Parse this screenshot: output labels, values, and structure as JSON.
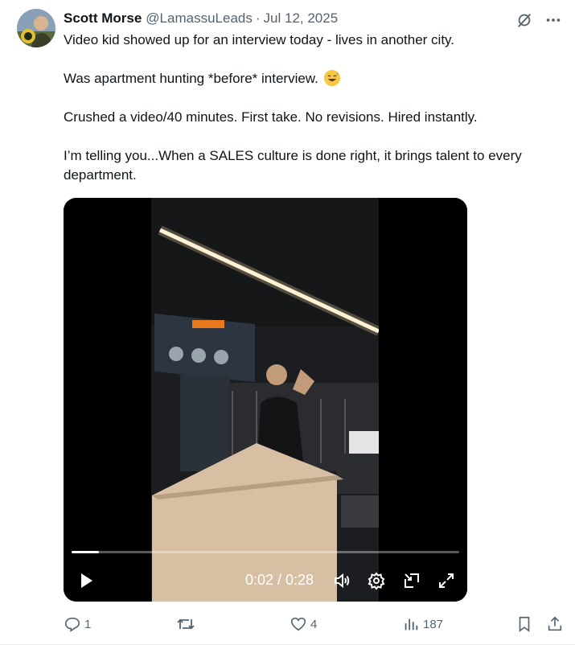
{
  "post": {
    "author_name": "Scott Morse",
    "author_handle": "@LamassuLeads",
    "separator": "·",
    "date": "Jul 12, 2025",
    "paragraphs": [
      "Video kid showed up for an interview today - lives in another city.",
      "Was apartment hunting *before* interview.",
      "Crushed a video/40 minutes. First take. No revisions. Hired instantly.",
      "I’m telling you...When a SALES culture is done right, it brings talent to every department."
    ],
    "emoji_name": "grinning-sweat-emoji"
  },
  "video": {
    "current_time": "0:02",
    "duration": "0:28",
    "time_display": "0:02 / 0:28",
    "progress_fraction": 0.071,
    "icons": [
      "play-icon",
      "volume-icon",
      "settings-icon",
      "picture-in-picture-icon",
      "fullscreen-icon"
    ]
  },
  "actions": {
    "reply_count": "1",
    "repost_count": "",
    "like_count": "4",
    "views_count": "187"
  },
  "colors": {
    "text_primary": "#0f1419",
    "text_secondary": "#536471",
    "accent_blue": "#1d9bf0",
    "background": "#ffffff"
  }
}
